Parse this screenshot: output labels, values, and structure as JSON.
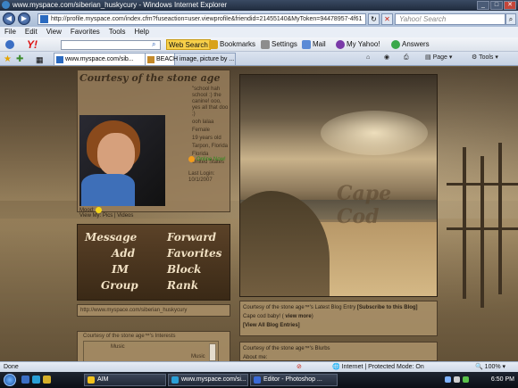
{
  "window": {
    "title": "www.myspace.com/siberian_huskycury - Windows Internet Explorer"
  },
  "address": {
    "url": "http://profile.myspace.com/index.cfm?fuseaction=user.viewprofile&friendid=21455140&MyToken=94478957-4f61"
  },
  "search": {
    "placeholder": "Yahoo! Search"
  },
  "menu": [
    "File",
    "Edit",
    "View",
    "Favorites",
    "Tools",
    "Help"
  ],
  "yahoo_toolbar": {
    "web_search": "Web Search",
    "bookmarks": "Bookmarks",
    "settings": "Settings",
    "mail": "Mail",
    "my_yahoo": "My Yahoo!",
    "answers": "Answers"
  },
  "tabs": [
    {
      "label": "www.myspace.com/sib..."
    },
    {
      "label": "BEACH image, picture by ..."
    }
  ],
  "tab_tools": {
    "page": "Page",
    "tools": "Tools"
  },
  "profile": {
    "name": "Courtesy of the stone age",
    "details": [
      "\"school hah school :) the canine! ooo, yes all that doo ;)",
      "ooh lalaa",
      "Female",
      "19 years old",
      "Tarpon, Florida",
      "Florida",
      "United States"
    ],
    "online": "Online Now!",
    "last_login": "Last Login: 10/1/2007",
    "mood_label": "Mood:",
    "view_my": "View My:",
    "pics": "Pics",
    "videos": "Videos"
  },
  "contact": {
    "message": "Message",
    "forward": "Forward",
    "add": "Add",
    "favorites": "Favorites",
    "im": "IM",
    "block": "Block",
    "group": "Group",
    "rank": "Rank"
  },
  "url_box": "http://www.myspace.com/siberian_huskycury",
  "interests": {
    "header": "Courtesy of the stone age™'s Interests",
    "general": "Music",
    "movies": "Music"
  },
  "beach": {
    "caption": "Cape Cod"
  },
  "blog": {
    "title": "Courtesy of the stone age™'s Latest Blog Entry",
    "subscribe": "[Subscribe to this Blog]",
    "entry": "Cape cod baby! (",
    "view_more": "view more",
    "view_all": "[View All Blog Entries]"
  },
  "blurbs": {
    "title": "Courtesy of the stone age™'s Blurbs",
    "about": "About me:"
  },
  "status": {
    "left": "Done",
    "zone": "Internet | Protected Mode: On",
    "zoom": "100%"
  },
  "taskbar": {
    "items": [
      "AIM",
      "www.myspace.com/si...",
      "Editor - Photoshop ..."
    ],
    "clock": "6:50 PM"
  },
  "colors": {
    "titlebar": "#1f2b3d",
    "taskbar": "#0b0f16",
    "page_bg": "#6b5a3e",
    "accent_sepia": "#c9b28a"
  }
}
